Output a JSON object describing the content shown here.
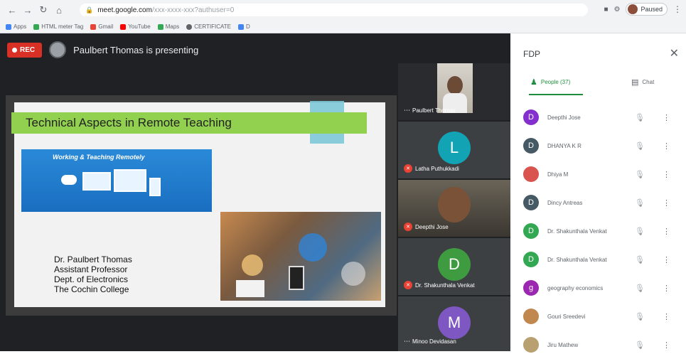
{
  "browser": {
    "url_domain": "meet.google.com",
    "url_path": "/xxx-xxxx-xxx?authuser=0",
    "profile_label": "Paused",
    "bookmarks": [
      {
        "label": "Apps",
        "color": "#4285f4"
      },
      {
        "label": "HTML meter Tag",
        "color": "#34a853"
      },
      {
        "label": "Gmail",
        "color": "#ea4335"
      },
      {
        "label": "YouTube",
        "color": "#ff0000"
      },
      {
        "label": "Maps",
        "color": "#34a853"
      },
      {
        "label": "CERTIFICATE",
        "color": "#5f6368"
      },
      {
        "label": "D",
        "color": "#4285f4"
      }
    ]
  },
  "meeting": {
    "rec_label": "REC",
    "presenting_text": "Paulbert Thomas is presenting"
  },
  "slide": {
    "title": "Technical Aspects in Remote Teaching",
    "banner_text": "Working & Teaching Remotely",
    "author_lines": [
      "Dr. Paulbert Thomas",
      "Assistant Professor",
      "Dept. of Electronics",
      "The Cochin College"
    ]
  },
  "tiles": [
    {
      "name": "Paulbert Thomas",
      "type": "video",
      "muted": false
    },
    {
      "name": "Latha Puthukkadi",
      "type": "letter",
      "letter": "L",
      "color": "#12a4b4",
      "muted": true
    },
    {
      "name": "Deepthi Jose",
      "type": "video",
      "muted": true
    },
    {
      "name": "Dr. Shakunthala Venkat",
      "type": "letter",
      "letter": "D",
      "color": "#3f9b3f",
      "muted": true
    },
    {
      "name": "Minoo Devidasan",
      "type": "letter",
      "letter": "M",
      "color": "#7e57c2",
      "muted": false
    }
  ],
  "panel": {
    "title": "FDP",
    "close_icon": "close-icon",
    "people_tab": "People (37)",
    "chat_tab": "Chat",
    "people": [
      {
        "name": "Deepthi Jose",
        "letter": "D",
        "color": "#8430ce"
      },
      {
        "name": "DHANYA K R",
        "letter": "D",
        "color": "#455a64"
      },
      {
        "name": "Dhiya M",
        "letter": "",
        "color": "#d9534f"
      },
      {
        "name": "Dincy Antreas",
        "letter": "D",
        "color": "#455a64"
      },
      {
        "name": "Dr. Shakunthala Venkat",
        "letter": "D",
        "color": "#33a852"
      },
      {
        "name": "Dr. Shakunthala Venkat",
        "letter": "D",
        "color": "#33a852"
      },
      {
        "name": "geography economics",
        "letter": "g",
        "color": "#9c27b0"
      },
      {
        "name": "Gouri Sreedevi",
        "letter": "",
        "color": "#c0874f"
      },
      {
        "name": "Jiru Mathew",
        "letter": "",
        "color": "#b8a070"
      }
    ]
  }
}
